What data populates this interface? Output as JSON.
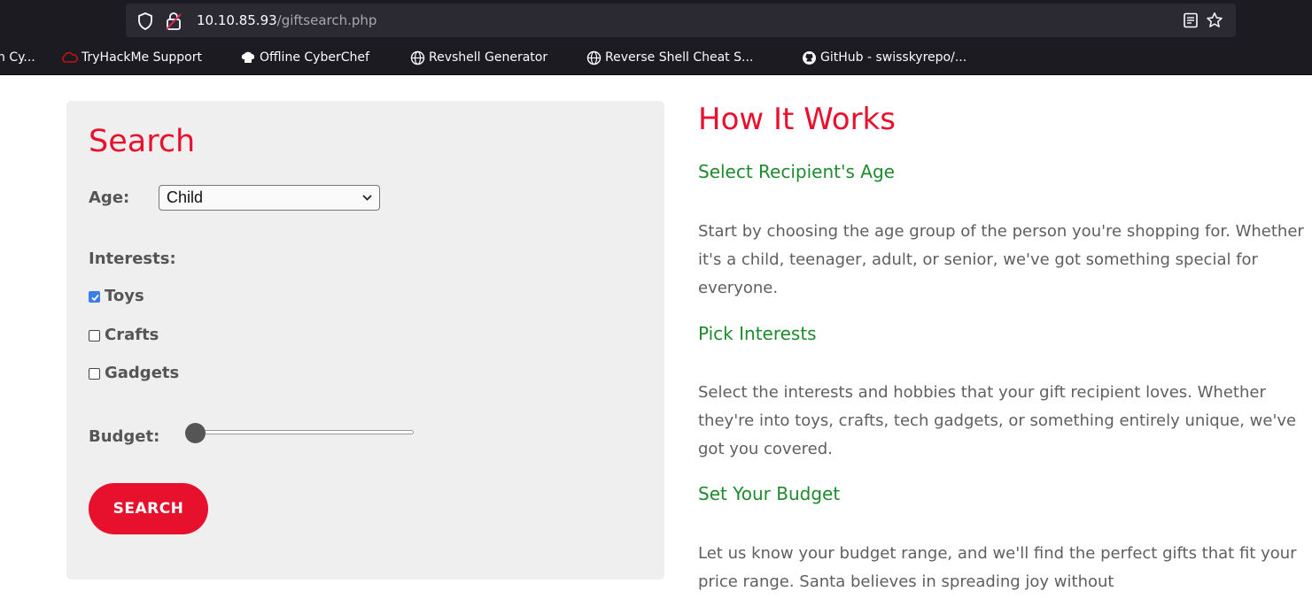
{
  "browser": {
    "url_host": "10.10.85.93",
    "url_path": "/giftsearch.php",
    "bookmarks": [
      {
        "label": "n Cy...",
        "icon": "none"
      },
      {
        "label": "TryHackMe Support",
        "icon": "tryhackme-cloud-icon"
      },
      {
        "label": "Offline CyberChef",
        "icon": "chef-hat-icon"
      },
      {
        "label": "Revshell Generator",
        "icon": "globe-icon"
      },
      {
        "label": "Reverse Shell Cheat S...",
        "icon": "globe-icon"
      },
      {
        "label": "GitHub - swisskyrepo/...",
        "icon": "github-icon"
      }
    ]
  },
  "search": {
    "title": "Search",
    "age_label": "Age:",
    "age_value": "Child",
    "interests_label": "Interests:",
    "interests": [
      {
        "label": "Toys",
        "checked": true
      },
      {
        "label": "Crafts",
        "checked": false
      },
      {
        "label": "Gadgets",
        "checked": false
      }
    ],
    "budget_label": "Budget:",
    "budget_level": 0,
    "button_label": "SEARCH"
  },
  "how_it_works": {
    "title": "How It Works",
    "steps": [
      {
        "title": "Select Recipient's Age",
        "text": "Start by choosing the age group of the person you're shopping for. Whether it's a child, teenager, adult, or senior, we've got something special for everyone."
      },
      {
        "title": "Pick Interests",
        "text": "Select the interests and hobbies that your gift recipient loves. Whether they're into toys, crafts, tech gadgets, or something entirely unique, we've got you covered."
      },
      {
        "title": "Set Your Budget",
        "text": "Let us know your budget range, and we'll find the perfect gifts that fit your price range. Santa believes in spreading joy without"
      }
    ]
  },
  "colors": {
    "accent": "#e8112d",
    "step_title": "#1e8a2e",
    "card_bg": "#efefef",
    "checkbox_checked": "#3b7ee8"
  }
}
